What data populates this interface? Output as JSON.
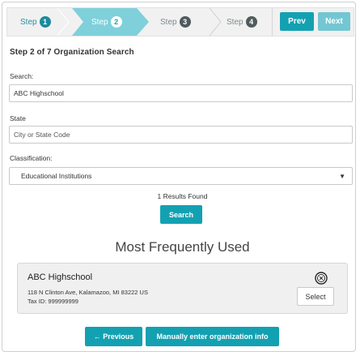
{
  "stepper": {
    "steps": [
      {
        "label": "Step",
        "number": "1"
      },
      {
        "label": "Step",
        "number": "2"
      },
      {
        "label": "Step",
        "number": "3"
      },
      {
        "label": "Step",
        "number": "4"
      }
    ],
    "prev_label": "Prev",
    "next_label": "Next"
  },
  "heading": "Step 2 of 7 Organization Search",
  "form": {
    "search_label": "Search:",
    "search_value": "ABC Highschool",
    "state_label": "State",
    "state_placeholder": "City or State Code",
    "classification_label": "Classification:",
    "classification_value": "Educational Institutions",
    "caret": "▼"
  },
  "results_text": "1 Results Found",
  "search_button": "Search",
  "mfu_title": "Most Frequently Used",
  "organization": {
    "name": "ABC Highschool",
    "address": "118 N Clinton Ave, Kalamazoo, MI 83222 US",
    "tax_id": "Tax ID: 999999999",
    "select_label": "Select",
    "icon": "seal-icon"
  },
  "footer": {
    "previous_label": "← Previous",
    "manual_label": "Manually enter organization info"
  },
  "colors": {
    "accent": "#13a1b2",
    "accent_light": "#73c7d2",
    "step_inactive_badge": "#4f5b5d"
  }
}
